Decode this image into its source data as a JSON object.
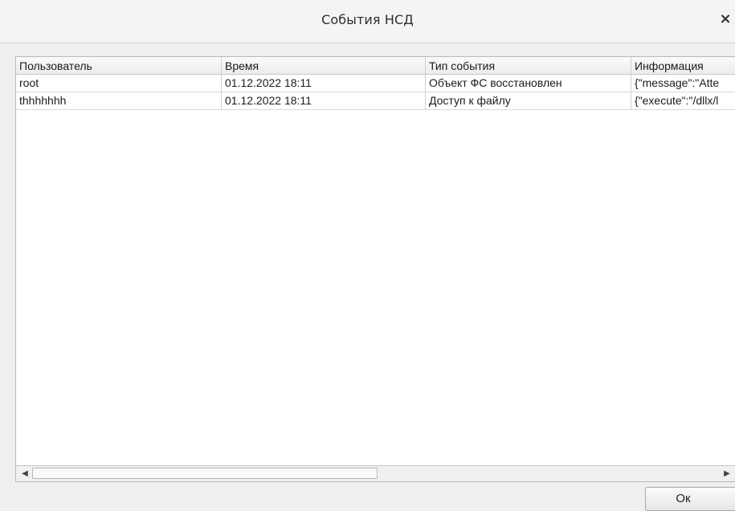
{
  "window": {
    "title": "События НСД",
    "close_glyph": "×"
  },
  "table": {
    "columns": [
      "Пользователь",
      "Время",
      "Тип события",
      "Информация"
    ],
    "rows": [
      [
        "root",
        "01.12.2022 18:11",
        "Объект ФС восстановлен",
        "{\"message\":\"Atte"
      ],
      [
        "thhhhhhh",
        "01.12.2022 18:11",
        "Доступ к файлу",
        "{\"execute\":\"/dllx/l"
      ]
    ]
  },
  "scrollbar": {
    "left_arrow": "◀",
    "right_arrow": "▶"
  },
  "footer": {
    "ok_label": "Ок"
  }
}
